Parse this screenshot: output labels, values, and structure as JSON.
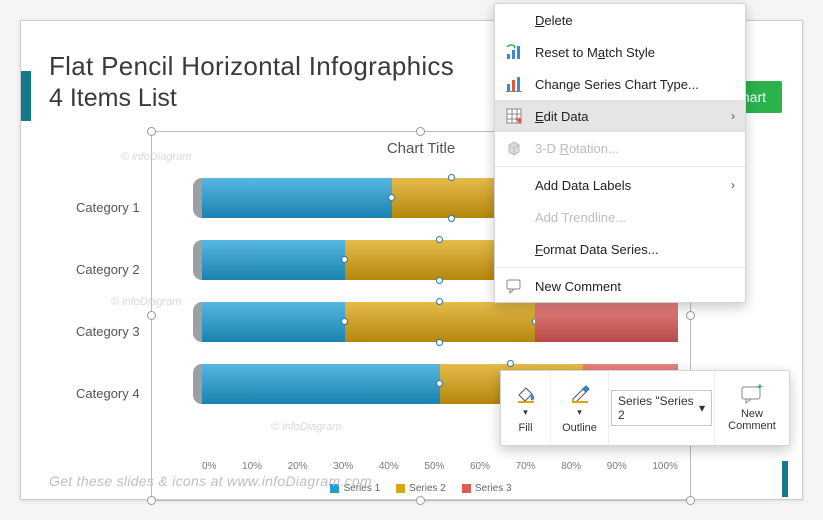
{
  "slide": {
    "title_line1": "Flat Pencil Horizontal Infographics",
    "title_line2": "4 Items List",
    "ribbon_button": "l Chart",
    "footer": "Get these slides & icons at www.infoDiagram.com",
    "watermark": "© infoDiagram"
  },
  "chart_data": {
    "type": "bar",
    "orientation": "horizontal",
    "stacked": "percent",
    "title": "Chart Title",
    "categories": [
      "Category 1",
      "Category 2",
      "Category 3",
      "Category 4"
    ],
    "series": [
      {
        "name": "Series 1",
        "color": "#1f9fd6",
        "values": [
          40,
          30,
          30,
          50
        ]
      },
      {
        "name": "Series 2",
        "color": "#dca40f",
        "values": [
          25,
          40,
          40,
          30
        ]
      },
      {
        "name": "Series 3",
        "color": "#e05a58",
        "values": [
          35,
          30,
          30,
          20
        ]
      }
    ],
    "xticks": [
      "0%",
      "10%",
      "20%",
      "30%",
      "40%",
      "50%",
      "60%",
      "70%",
      "80%",
      "90%",
      "100%"
    ],
    "xlabel": "",
    "ylabel": "",
    "xlim": [
      0,
      100
    ],
    "selected_series_index": 1
  },
  "context_menu": {
    "items": [
      {
        "key": "delete",
        "label": "Delete",
        "u": "D",
        "icon": "",
        "disabled": false
      },
      {
        "key": "reset",
        "label": "Reset to Match Style",
        "u": "a",
        "icon": "reset",
        "disabled": false
      },
      {
        "key": "change-type",
        "label": "Change Series Chart Type...",
        "u": "Y",
        "icon": "chart",
        "disabled": false
      },
      {
        "key": "edit-data",
        "label": "Edit Data",
        "u": "E",
        "icon": "grid",
        "disabled": false,
        "submenu": true,
        "hover": true
      },
      {
        "key": "rotation",
        "label": "3-D Rotation...",
        "u": "R",
        "icon": "cube",
        "disabled": true
      },
      {
        "key": "labels",
        "label": "Add Data Labels",
        "u": "",
        "icon": "",
        "disabled": false,
        "submenu": true
      },
      {
        "key": "trendline",
        "label": "Add Trendline...",
        "u": "",
        "icon": "",
        "disabled": true
      },
      {
        "key": "format",
        "label": "Format Data Series...",
        "u": "F",
        "icon": "",
        "disabled": false
      },
      {
        "key": "comment",
        "label": "New Comment",
        "u": "M",
        "icon": "comment",
        "disabled": false
      }
    ]
  },
  "mini_toolbar": {
    "fill_label": "Fill",
    "outline_label": "Outline",
    "series_selector": "Series \"Series 2",
    "new_comment": "New Comment"
  }
}
